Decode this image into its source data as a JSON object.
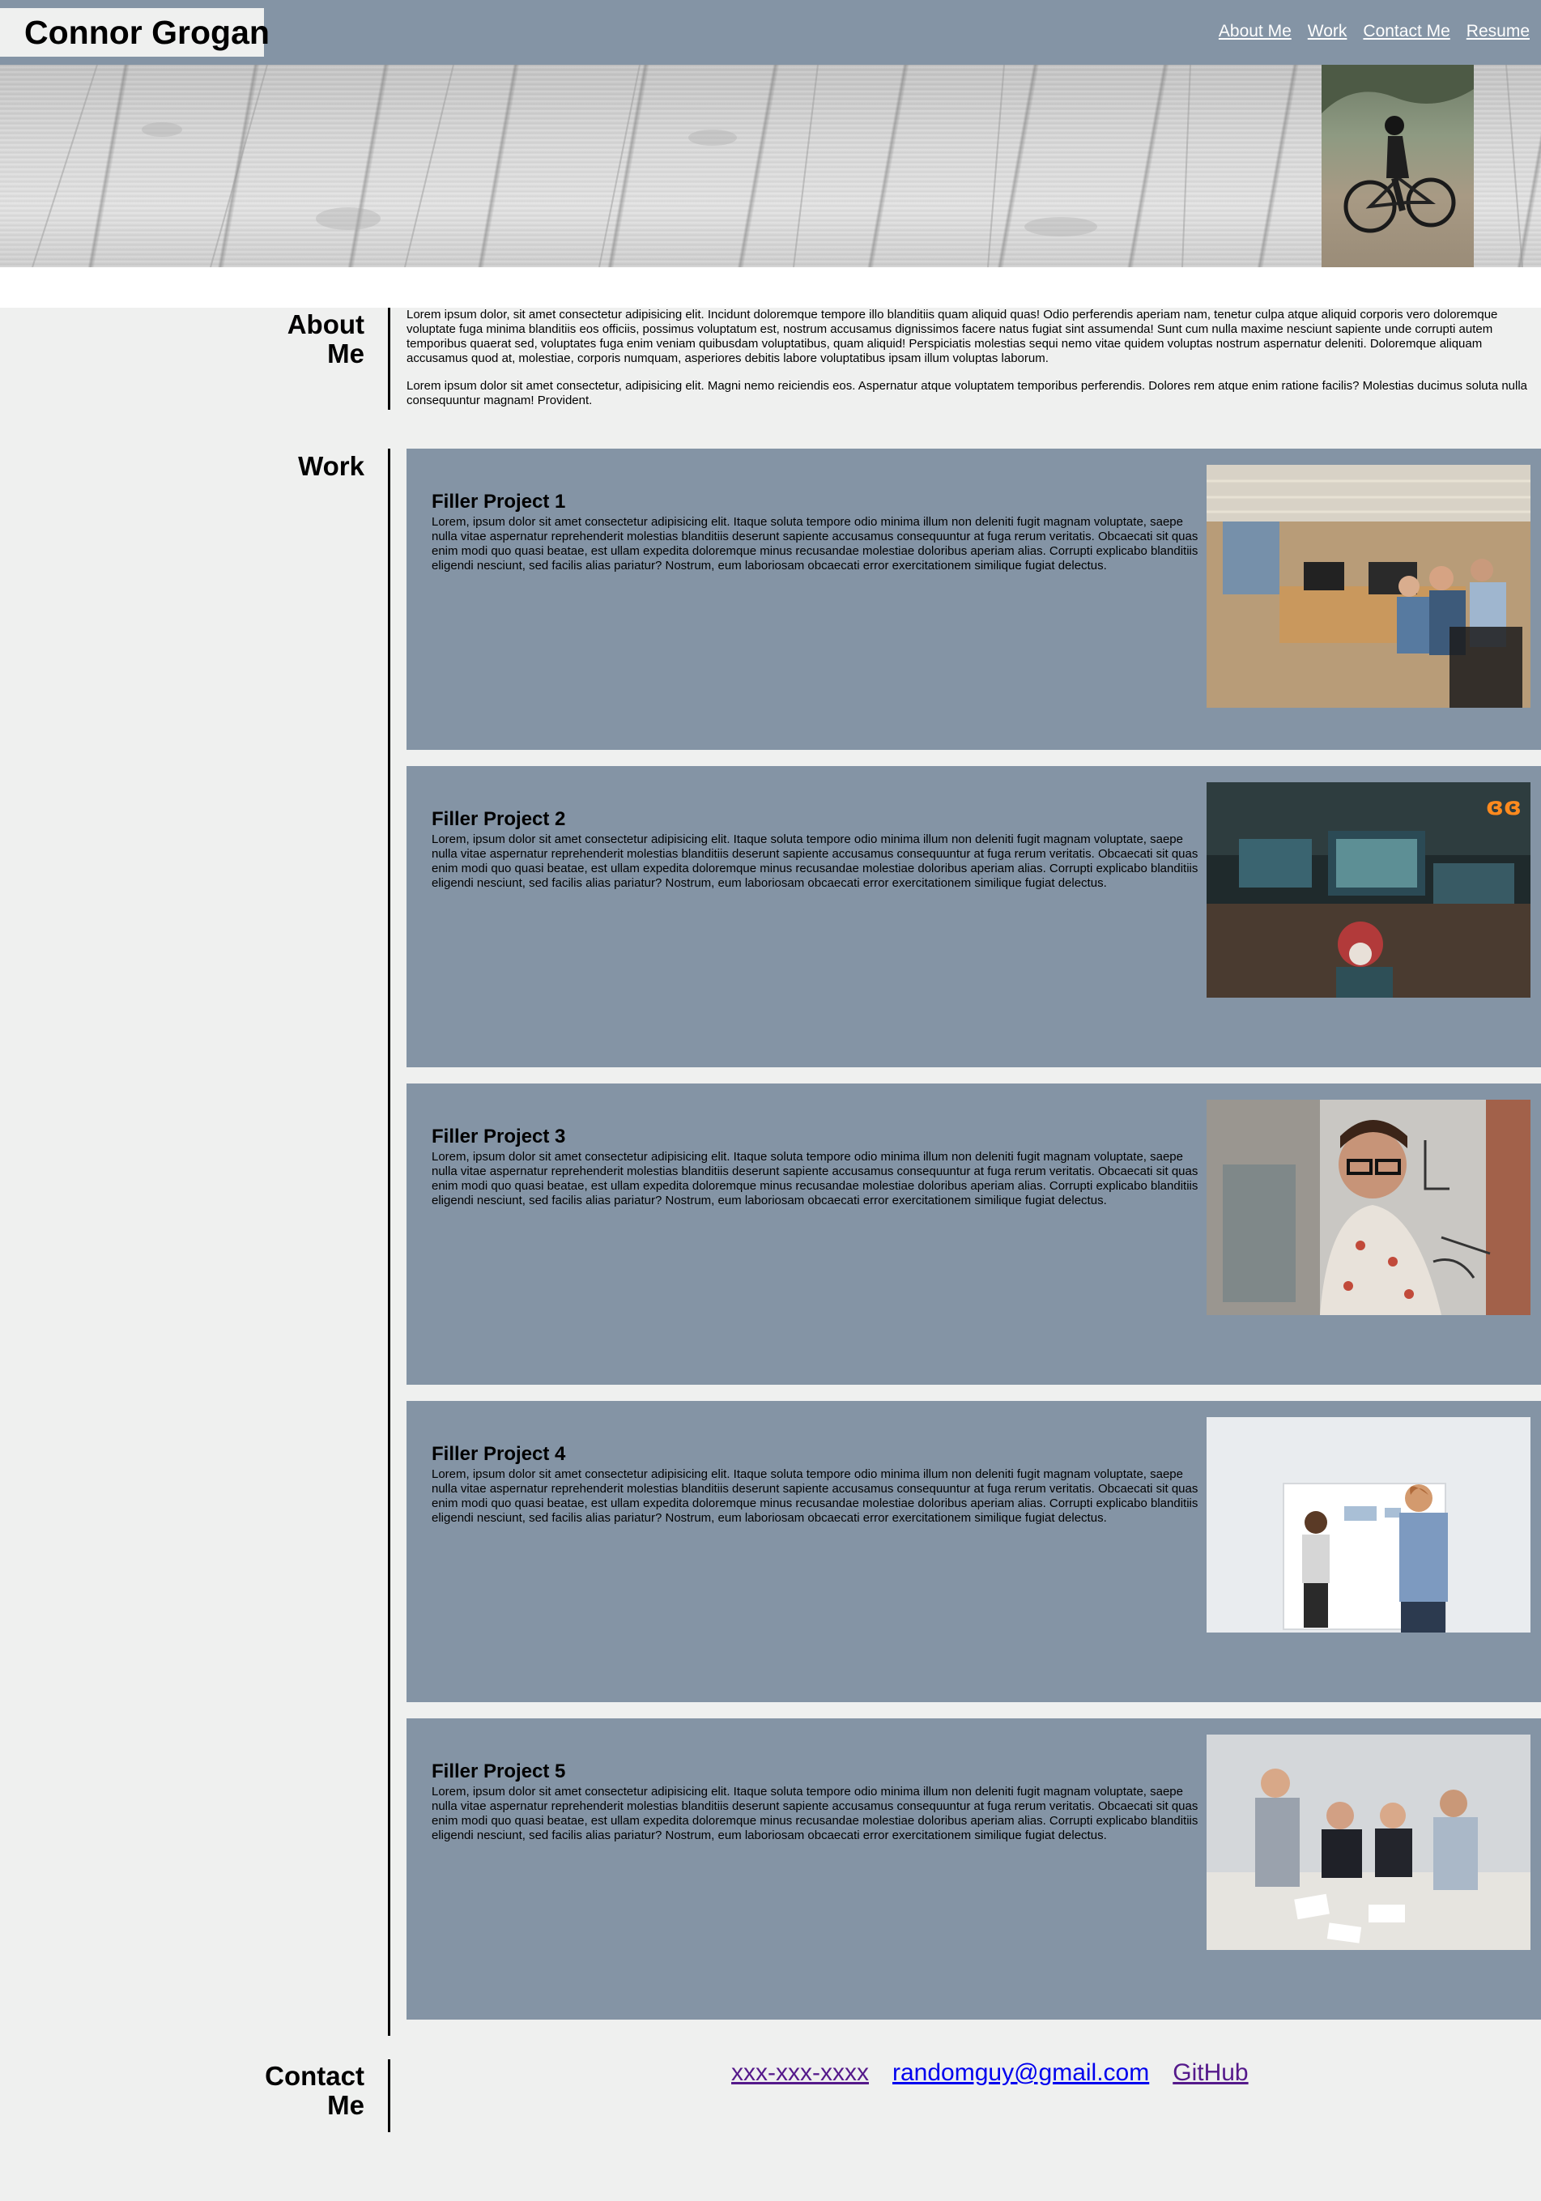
{
  "header": {
    "title": "Connor Grogan",
    "nav": [
      {
        "label": "About Me"
      },
      {
        "label": "Work"
      },
      {
        "label": "Contact Me"
      },
      {
        "label": "Resume"
      }
    ]
  },
  "about": {
    "heading_line1": "About",
    "heading_line2": "Me",
    "paragraphs": [
      "Lorem ipsum dolor, sit amet consectetur adipisicing elit. Incidunt doloremque tempore illo blanditiis quam aliquid quas! Odio perferendis aperiam nam, tenetur culpa atque aliquid corporis vero doloremque voluptate fuga minima blanditiis eos officiis, possimus voluptatum est, nostrum accusamus dignissimos facere natus fugiat sint assumenda! Sunt cum nulla maxime nesciunt sapiente unde corrupti autem temporibus quaerat sed, voluptates fuga enim veniam quibusdam voluptatibus, quam aliquid! Perspiciatis molestias sequi nemo vitae quidem voluptas nostrum aspernatur deleniti. Doloremque aliquam accusamus quod at, molestiae, corporis numquam, asperiores debitis labore voluptatibus ipsam illum voluptas laborum.",
      "Lorem ipsum dolor sit amet consectetur, adipisicing elit. Magni nemo reiciendis eos. Aspernatur atque voluptatem temporibus perferendis. Dolores rem atque enim ratione facilis? Molestias ducimus soluta nulla consequuntur magnam! Provident."
    ]
  },
  "work": {
    "heading": "Work",
    "projects": [
      {
        "title": "Filler Project 1",
        "description": "Lorem, ipsum dolor sit amet consectetur adipisicing elit. Itaque soluta tempore odio minima illum non deleniti fugit magnam voluptate, saepe nulla vitae aspernatur reprehenderit molestias blanditiis deserunt sapiente accusamus consequuntur at fuga rerum veritatis. Obcaecati sit quas enim modi quo quasi beatae, est ullam expedita doloremque minus recusandae molestiae doloribus aperiam alias. Corrupti explicabo blanditiis eligendi nesciunt, sed facilis alias pariatur? Nostrum, eum laboriosam obcaecati error exercitationem similique fugiat delectus.",
        "image": "office-coworkers-photo"
      },
      {
        "title": "Filler Project 2",
        "description": "Lorem, ipsum dolor sit amet consectetur adipisicing elit. Itaque soluta tempore odio minima illum non deleniti fugit magnam voluptate, saepe nulla vitae aspernatur reprehenderit molestias blanditiis deserunt sapiente accusamus consequuntur at fuga rerum veritatis. Obcaecati sit quas enim modi quo quasi beatae, est ullam expedita doloremque minus recusandae molestiae doloribus aperiam alias. Corrupti explicabo blanditiis eligendi nesciunt, sed facilis alias pariatur? Nostrum, eum laboriosam obcaecati error exercitationem similique fugiat delectus.",
        "image": "dark-computer-room-photo"
      },
      {
        "title": "Filler Project 3",
        "description": "Lorem, ipsum dolor sit amet consectetur adipisicing elit. Itaque soluta tempore odio minima illum non deleniti fugit magnam voluptate, saepe nulla vitae aspernatur reprehenderit molestias blanditiis deserunt sapiente accusamus consequuntur at fuga rerum veritatis. Obcaecati sit quas enim modi quo quasi beatae, est ullam expedita doloremque minus recusandae molestiae doloribus aperiam alias. Corrupti explicabo blanditiis eligendi nesciunt, sed facilis alias pariatur? Nostrum, eum laboriosam obcaecati error exercitationem similique fugiat delectus.",
        "image": "glass-writing-photo"
      },
      {
        "title": "Filler Project 4",
        "description": "Lorem, ipsum dolor sit amet consectetur adipisicing elit. Itaque soluta tempore odio minima illum non deleniti fugit magnam voluptate, saepe nulla vitae aspernatur reprehenderit molestias blanditiis deserunt sapiente accusamus consequuntur at fuga rerum veritatis. Obcaecati sit quas enim modi quo quasi beatae, est ullam expedita doloremque minus recusandae molestiae doloribus aperiam alias. Corrupti explicabo blanditiis eligendi nesciunt, sed facilis alias pariatur? Nostrum, eum laboriosam obcaecati error exercitationem similique fugiat delectus.",
        "image": "whiteboard-meeting-photo"
      },
      {
        "title": "Filler Project 5",
        "description": "Lorem, ipsum dolor sit amet consectetur adipisicing elit. Itaque soluta tempore odio minima illum non deleniti fugit magnam voluptate, saepe nulla vitae aspernatur reprehenderit molestias blanditiis deserunt sapiente accusamus consequuntur at fuga rerum veritatis. Obcaecati sit quas enim modi quo quasi beatae, est ullam expedita doloremque minus recusandae molestiae doloribus aperiam alias. Corrupti explicabo blanditiis eligendi nesciunt, sed facilis alias pariatur? Nostrum, eum laboriosam obcaecati error exercitationem similique fugiat delectus.",
        "image": "business-team-photo"
      }
    ]
  },
  "contact": {
    "heading_line1": "Contact",
    "heading_line2": "Me",
    "links": [
      {
        "label": "xxx-xxx-xxxx",
        "color": "#551a8b"
      },
      {
        "label": "randomguy@gmail.com",
        "color": "#0000ee"
      },
      {
        "label": "GitHub",
        "color": "#551a8b"
      }
    ]
  },
  "colors": {
    "header_bg": "#8494a5",
    "page_bg": "#eff0ef",
    "card_bg": "#8494a5",
    "nav_link": "#ffffff"
  }
}
